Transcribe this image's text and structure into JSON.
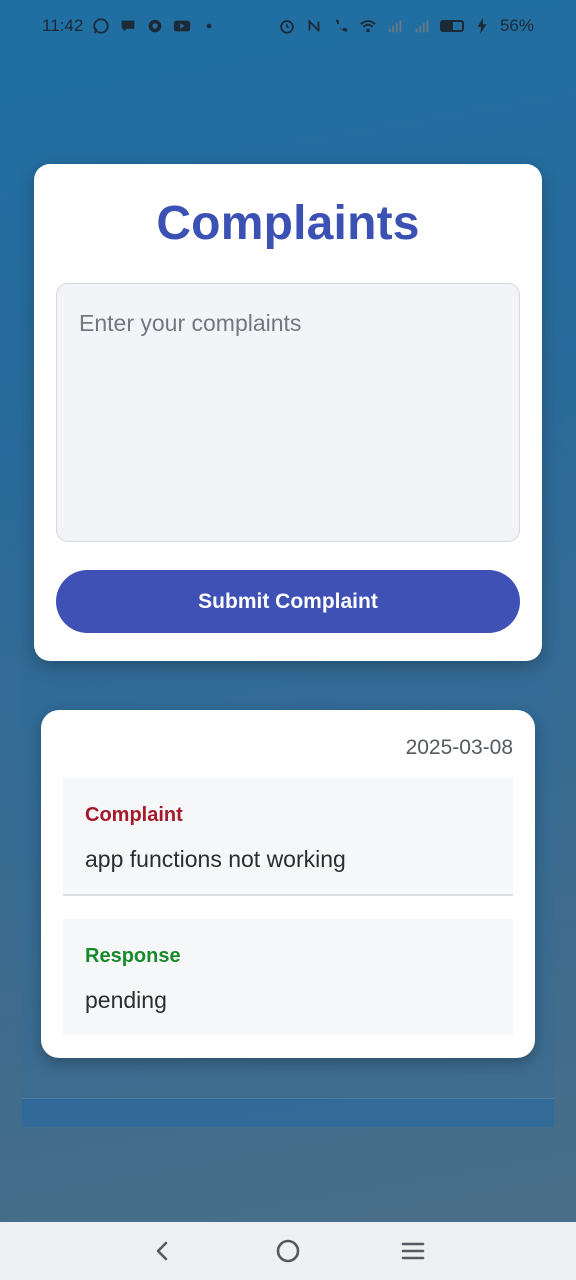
{
  "status_bar": {
    "time": "11:42",
    "battery_percent": "56%",
    "battery_level": 0.56,
    "notification_icons": [
      "whatsapp-icon",
      "messages-icon",
      "game-controller-icon",
      "youtube-icon",
      "dot-icon"
    ],
    "system_icons": [
      "alarm-icon",
      "nfc-icon",
      "wifi-call-icon",
      "wifi-icon",
      "signal-icon",
      "signal-icon",
      "battery-icon",
      "charging-icon"
    ]
  },
  "form": {
    "title": "Complaints",
    "textarea_placeholder": "Enter your complaints",
    "textarea_value": "",
    "submit_label": "Submit Complaint"
  },
  "history": [
    {
      "date": "2025-03-08",
      "complaint_label": "Complaint",
      "complaint_text": "app functions not working",
      "response_label": "Response",
      "response_text": "pending"
    }
  ],
  "nav_bar": {
    "buttons": [
      "back-icon",
      "home-icon",
      "recent-apps-icon"
    ]
  },
  "colors": {
    "accent": "#3f51b5",
    "title": "#3b51b3",
    "complaint_label": "#a31b2a",
    "response_label": "#178a2a",
    "background_top": "#1f6fa3",
    "background_bottom": "#4b6f88"
  }
}
